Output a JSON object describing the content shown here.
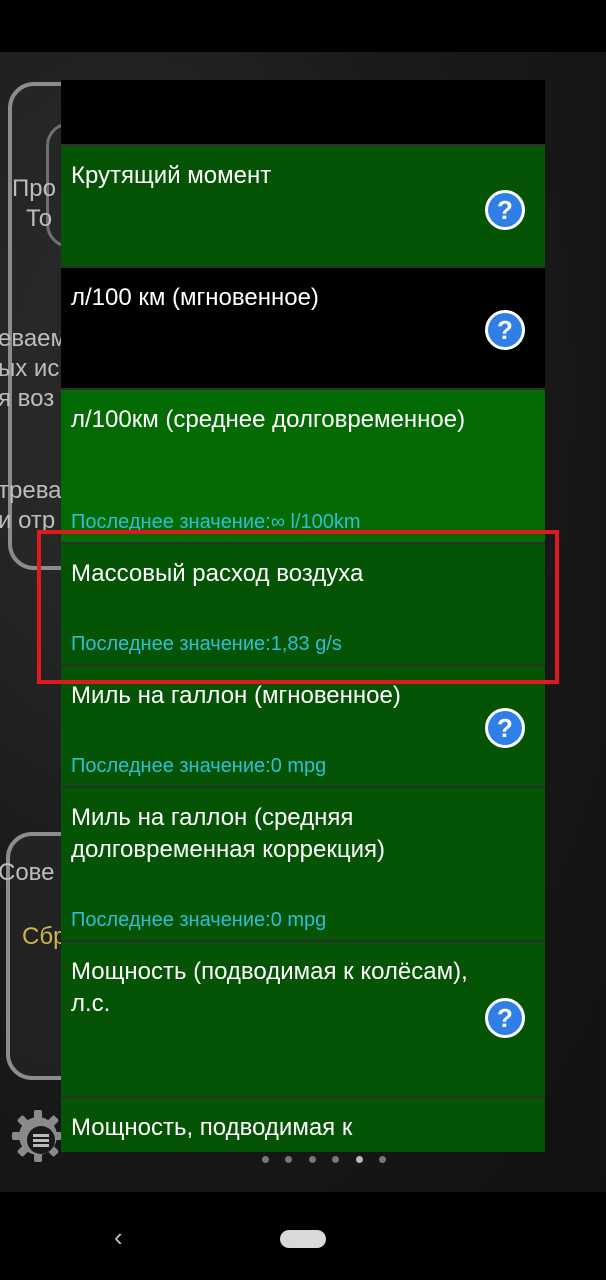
{
  "background": {
    "top_card_lines": [
      "Про",
      "То"
    ],
    "mid_lines": [
      "еваем",
      "ых ис",
      "я воз"
    ],
    "lower_lines": [
      "трева",
      "и отр"
    ],
    "bottom_card_line": "Сове",
    "bottom_card_button": "Сбр"
  },
  "list": {
    "items": [
      {
        "title": "Крутящий момент",
        "last": ""
      },
      {
        "title": "л/100 км (мгновенное)",
        "last": ""
      },
      {
        "title": "л/100км (среднее долговременное)",
        "last": "Последнее значение:∞ l/100km"
      },
      {
        "title": "Массовый расход воздуха",
        "last": "Последнее значение:1,83 g/s"
      },
      {
        "title": "Миль на галлон (мгновенное)",
        "last": "Последнее значение:0 mpg"
      },
      {
        "title": "Миль на галлон (средняя долговременная коррекция)",
        "last": "Последнее значение:0 mpg"
      },
      {
        "title": "Мощность (подводимая к колёсам), л.с.",
        "last": ""
      },
      {
        "title": "Мощность, подводимая к",
        "last": ""
      }
    ],
    "help_glyph": "?"
  },
  "nav": {
    "back_glyph": "‹"
  },
  "colors": {
    "item_dark_green": "#055305",
    "item_green": "#046a04",
    "last_value_text": "#2fbfd4",
    "help_icon_fill": "#2f7fe6",
    "highlight_frame": "#e0191f"
  }
}
